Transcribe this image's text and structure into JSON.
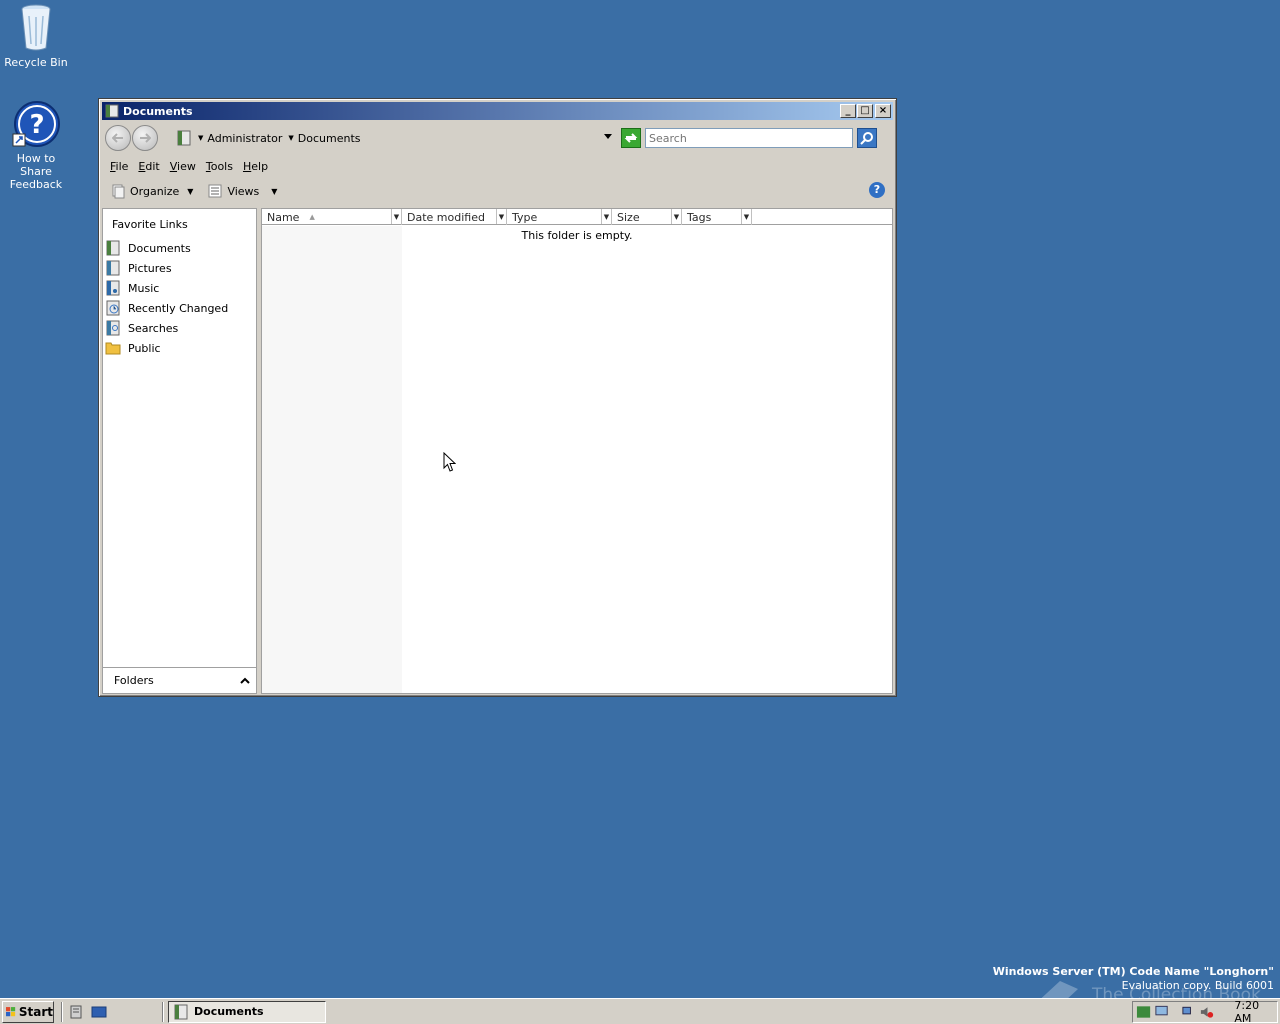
{
  "desktop": {
    "icons": [
      {
        "label": "Recycle Bin",
        "icon": "recycle-bin-icon"
      },
      {
        "label": "How to Share Feedback",
        "icon": "help-icon"
      }
    ],
    "watermark": {
      "line1": "Windows Server (TM) Code Name \"Longhorn\"",
      "line2": "Evaluation copy. Build 6001"
    },
    "brand": "The Collection Book"
  },
  "window": {
    "title": "Documents",
    "controls": {
      "minimize": "_",
      "maximize": "□",
      "close": "×"
    },
    "address": {
      "crumbs": [
        "Administrator",
        "Documents"
      ]
    },
    "search": {
      "placeholder": "Search"
    },
    "menu": [
      {
        "label": "File",
        "accel": "F",
        "rest": "ile"
      },
      {
        "label": "Edit",
        "accel": "E",
        "rest": "dit"
      },
      {
        "label": "View",
        "accel": "V",
        "rest": "iew"
      },
      {
        "label": "Tools",
        "accel": "T",
        "rest": "ools"
      },
      {
        "label": "Help",
        "accel": "H",
        "rest": "elp"
      }
    ],
    "commands": {
      "organize": "Organize",
      "views": "Views"
    },
    "navpane": {
      "heading": "Favorite Links",
      "links": [
        "Documents",
        "Pictures",
        "Music",
        "Recently Changed",
        "Searches",
        "Public"
      ],
      "folders_label": "Folders"
    },
    "columns": [
      "Name",
      "Date modified",
      "Type",
      "Size",
      "Tags"
    ],
    "empty_message": "This folder is empty."
  },
  "taskbar": {
    "start_label": "Start",
    "task_label": "Documents",
    "clock": "7:20 AM"
  },
  "colors": {
    "desktop": "#3a6ea5",
    "title_start": "#0a246a",
    "title_end": "#a6caf0",
    "chrome": "#d4d0c8"
  }
}
